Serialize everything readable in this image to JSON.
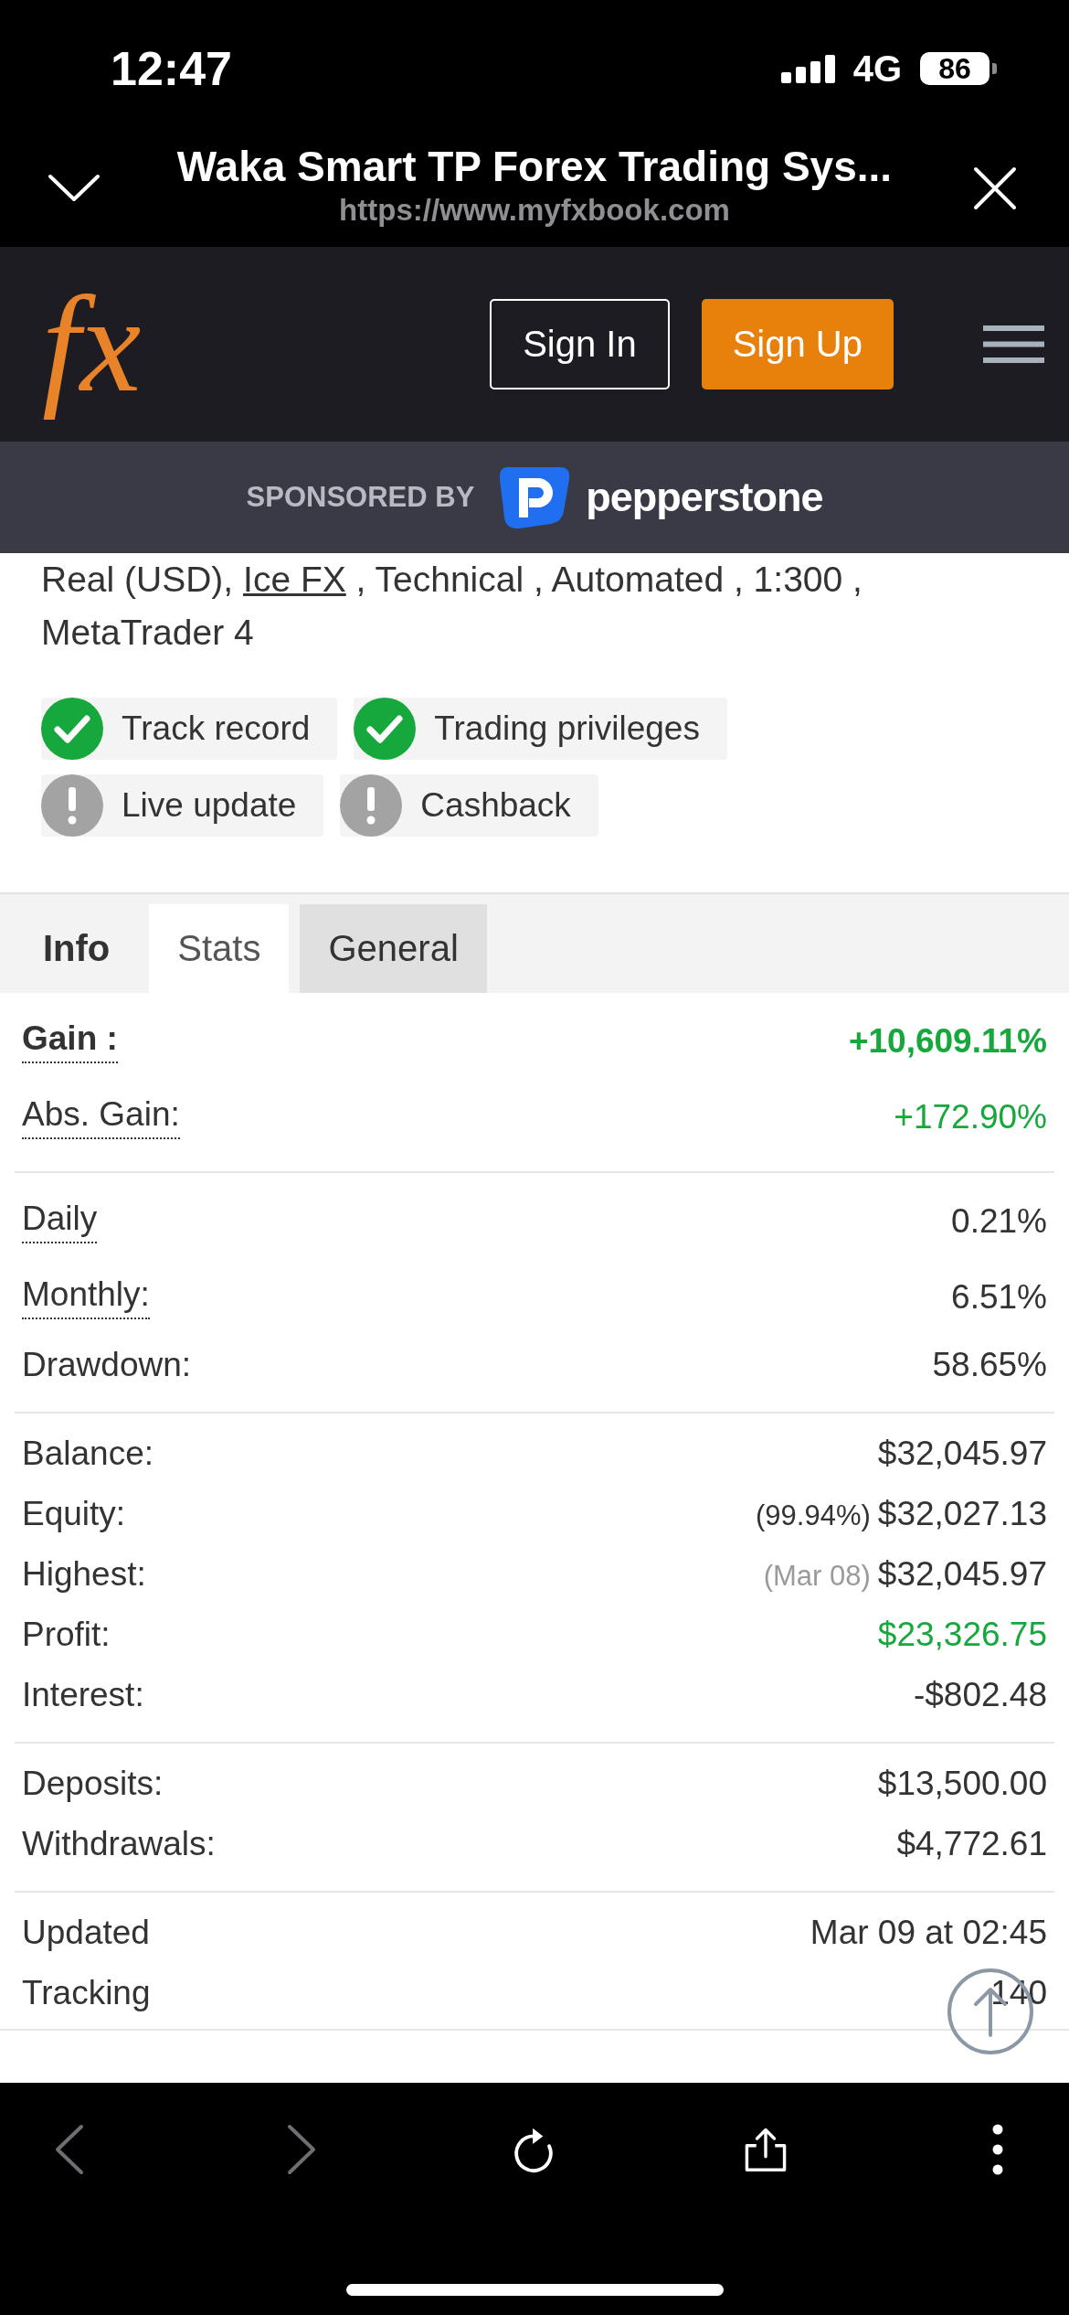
{
  "status_bar": {
    "time": "12:47",
    "network": "4G",
    "battery": "86"
  },
  "browser_header": {
    "title": "Waka Smart TP Forex Trading Sys...",
    "url": "https://www.myfxbook.com"
  },
  "site_header": {
    "logo": "fx",
    "buttons": [
      {
        "label": "Sign In",
        "kind": "outline"
      },
      {
        "label": "Sign Up",
        "kind": "filled"
      }
    ]
  },
  "sponsor_bar": {
    "label": "SPONSORED BY",
    "sponsor": "pepperstone"
  },
  "account_info": {
    "prefix": "Real (USD), ",
    "link": "Ice FX",
    "suffix": " , Technical , Automated , 1:300 , MetaTrader 4"
  },
  "badges": [
    {
      "label": "Track record",
      "verified": true
    },
    {
      "label": "Trading privileges",
      "verified": true
    },
    {
      "label": "Live update",
      "verified": false
    },
    {
      "label": "Cashback",
      "verified": false
    }
  ],
  "tabs": [
    {
      "label": "Info",
      "selected": false,
      "hovered": false,
      "bold": true
    },
    {
      "label": "Stats",
      "selected": true,
      "hovered": false,
      "bold": false
    },
    {
      "label": "General",
      "selected": false,
      "hovered": true,
      "bold": false
    }
  ],
  "stats_groups": [
    {
      "rows": [
        {
          "label": "Gain :",
          "value": "+10,609.11%",
          "hint": true,
          "bold": true,
          "positive": true
        },
        {
          "label": "Abs. Gain:",
          "value": "+172.90%",
          "hint": true,
          "bold": false,
          "positive": true
        }
      ]
    },
    {
      "rows": [
        {
          "label": "Daily",
          "value": "0.21%",
          "hint": true,
          "bold": false,
          "positive": false
        },
        {
          "label": "Monthly:",
          "value": "6.51%",
          "hint": true,
          "bold": false,
          "positive": false
        },
        {
          "label": "Drawdown:",
          "value": "58.65%",
          "hint": false,
          "bold": false,
          "positive": false
        }
      ]
    },
    {
      "rows": [
        {
          "label": "Balance:",
          "value": "$32,045.97",
          "hint": false,
          "bold": false,
          "positive": false
        },
        {
          "label": "Equity:",
          "note": {
            "text": "(99.94%)",
            "muted": false
          },
          "value": "$32,027.13",
          "hint": false,
          "bold": false,
          "positive": false
        },
        {
          "label": "Highest:",
          "note": {
            "text": "(Mar 08)",
            "muted": true
          },
          "value": "$32,045.97",
          "hint": false,
          "bold": false,
          "positive": false
        },
        {
          "label": "Profit:",
          "value": "$23,326.75",
          "hint": false,
          "bold": false,
          "positive": true
        },
        {
          "label": "Interest:",
          "value": "-$802.48",
          "hint": false,
          "bold": false,
          "positive": false
        }
      ]
    },
    {
      "rows": [
        {
          "label": "Deposits:",
          "value": "$13,500.00",
          "hint": false,
          "bold": false,
          "positive": false
        },
        {
          "label": "Withdrawals:",
          "value": "$4,772.61",
          "hint": false,
          "bold": false,
          "positive": false
        }
      ]
    },
    {
      "rows": [
        {
          "label": "Updated",
          "value": "Mar 09 at 02:45",
          "hint": false,
          "bold": false,
          "positive": false
        },
        {
          "label": "Tracking",
          "value": "140",
          "hint": false,
          "bold": false,
          "positive": false
        }
      ]
    }
  ],
  "toolbar": [
    {
      "kind": "back",
      "disabled": true
    },
    {
      "kind": "forward",
      "disabled": true
    },
    {
      "kind": "reload",
      "disabled": false
    },
    {
      "kind": "share",
      "disabled": false
    },
    {
      "kind": "more",
      "disabled": false
    }
  ]
}
